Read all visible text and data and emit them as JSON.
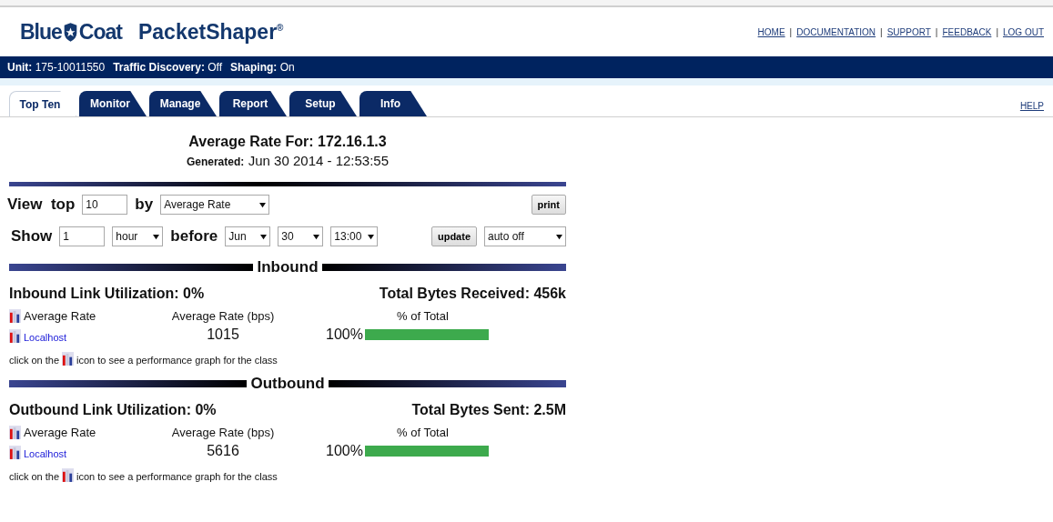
{
  "logo": {
    "brand_left": "Blue",
    "brand_right": "Coat",
    "product": "PacketShaper",
    "mark": "®"
  },
  "top_links": [
    "HOME",
    "DOCUMENTATION",
    "SUPPORT",
    "FEEDBACK",
    "LOG OUT"
  ],
  "link_separator": "|",
  "status_bar": [
    {
      "label": "Unit:",
      "value": "175-10011550"
    },
    {
      "label": "Traffic Discovery:",
      "value": "Off"
    },
    {
      "label": "Shaping:",
      "value": "On"
    }
  ],
  "tabs": [
    {
      "label": "Top Ten",
      "selected": true
    },
    {
      "label": "Monitor",
      "selected": false
    },
    {
      "label": "Manage",
      "selected": false
    },
    {
      "label": "Report",
      "selected": false
    },
    {
      "label": "Setup",
      "selected": false
    },
    {
      "label": "Info",
      "selected": false
    }
  ],
  "help_link": "HELP",
  "heading": {
    "title": "Average Rate For: 172.16.1.3",
    "generated_label": "Generated:",
    "generated_value": "Jun 30 2014 - 12:53:55"
  },
  "controls": {
    "view_label": "View  top",
    "top_count": "10",
    "by_label": "by",
    "by_select": "Average Rate",
    "print_button": "print",
    "show_label": "Show",
    "show_count": "1",
    "unit_select": "hour",
    "before_label": "before",
    "month_select": "Jun",
    "day_select": "30",
    "time_select": "13:00",
    "update_button": "update",
    "auto_select": "auto off"
  },
  "sections": [
    {
      "title": "Inbound",
      "utilization": "Inbound Link Utilization: 0%",
      "total": "Total Bytes Received: 456k",
      "col_class": "Average Rate",
      "col_rate": "Average Rate (bps)",
      "col_share": "% of Total",
      "rows": [
        {
          "name": "Localhost",
          "rate": "1015",
          "share": "100%",
          "level": 1
        }
      ],
      "note_before": "click on the",
      "note_after": "icon to see a performance graph for the class"
    },
    {
      "title": "Outbound",
      "utilization": "Outbound Link Utilization: 0%",
      "total": "Total Bytes Sent: 2.5M",
      "col_class": "Average Rate",
      "col_rate": "Average Rate (bps)",
      "col_share": "% of Total",
      "rows": [
        {
          "name": "Localhost",
          "rate": "5616",
          "share": "100%",
          "level": 1
        }
      ],
      "note_before": "click on the",
      "note_after": "icon to see a performance graph for the class"
    }
  ]
}
